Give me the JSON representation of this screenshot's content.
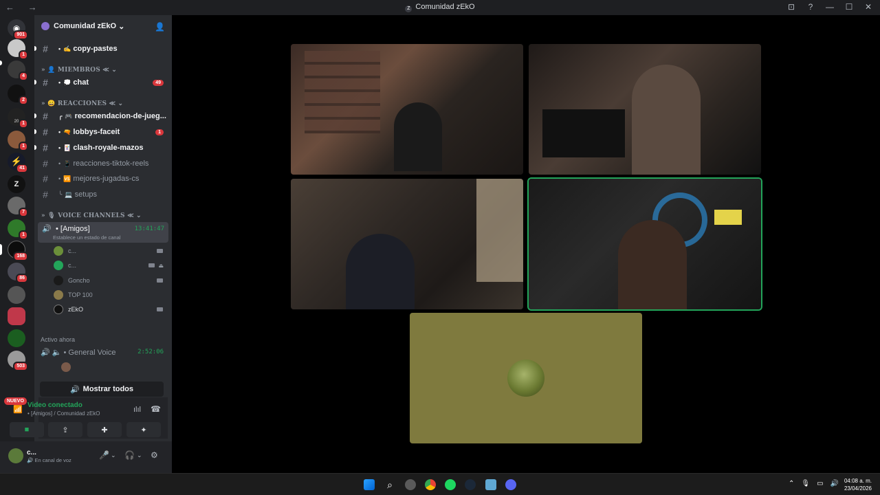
{
  "window": {
    "title": "Comunidad zEkO",
    "nav": "←  →",
    "controls": [
      "⊡",
      "?",
      "—",
      "☐",
      "✕"
    ]
  },
  "rail": {
    "badges": [
      "901",
      "1",
      "4",
      "2",
      "1",
      "1",
      "41",
      "7",
      "1",
      "168",
      "86",
      "503"
    ],
    "mid_label": "20",
    "nuevo": "NUEVO"
  },
  "sidebar": {
    "guild_name": "Comunidad zEkO",
    "guild_chevron": "⌄",
    "channels": [
      {
        "name": "copy-pastes",
        "emoji": "✍",
        "unread": true
      },
      {
        "name": "chat",
        "emoji": "💭",
        "unread": true,
        "badge": "49"
      },
      {
        "name": "recomendacion-de-jueg...",
        "emoji": "🎮",
        "unread": true
      },
      {
        "name": "lobbys-faceit",
        "emoji": "🔫",
        "unread": true,
        "badge": "1"
      },
      {
        "name": "clash-royale-mazos",
        "emoji": "🃏",
        "unread": true
      },
      {
        "name": "reacciones-tiktok-reels",
        "emoji": "📱",
        "unread": false
      },
      {
        "name": "mejores-jugadas-cs",
        "emoji": "🆚",
        "unread": false
      },
      {
        "name": "setups",
        "emoji": "💻",
        "unread": false
      }
    ],
    "categories": {
      "miembros": "MIEMBROS ≪",
      "reacciones": "REACCIONES ≪",
      "voice": "VOICE CHANNELS ≪"
    },
    "voice_channel": {
      "name": "[Amigos]",
      "time": "13:41:47",
      "status": "Establece un estado de canal"
    },
    "voice_users": [
      {
        "name": "c...",
        "camera": true
      },
      {
        "name": "c...",
        "camera": true
      },
      {
        "name": "Goncho",
        "camera": true
      },
      {
        "name": "TOP 100",
        "camera": false
      },
      {
        "name": "zEkO",
        "camera": true
      }
    ],
    "active_now": "Activo ahora",
    "general_voice": {
      "name": "General Voice",
      "time": "2:52:06"
    },
    "show_all": "Mostrar todos"
  },
  "voice_panel": {
    "status": "Video conectado",
    "location": "[Amigos] / Comunidad zEkO"
  },
  "user": {
    "name": "c...",
    "status": "En canal de voz"
  },
  "taskbar": {
    "time": "04:08 a. m.",
    "date": "23/04/2026"
  },
  "colors": {
    "accent_green": "#23a55a",
    "badge_red": "#da373c",
    "bg_dark": "#1e1f22",
    "sidebar": "#2b2d31"
  }
}
